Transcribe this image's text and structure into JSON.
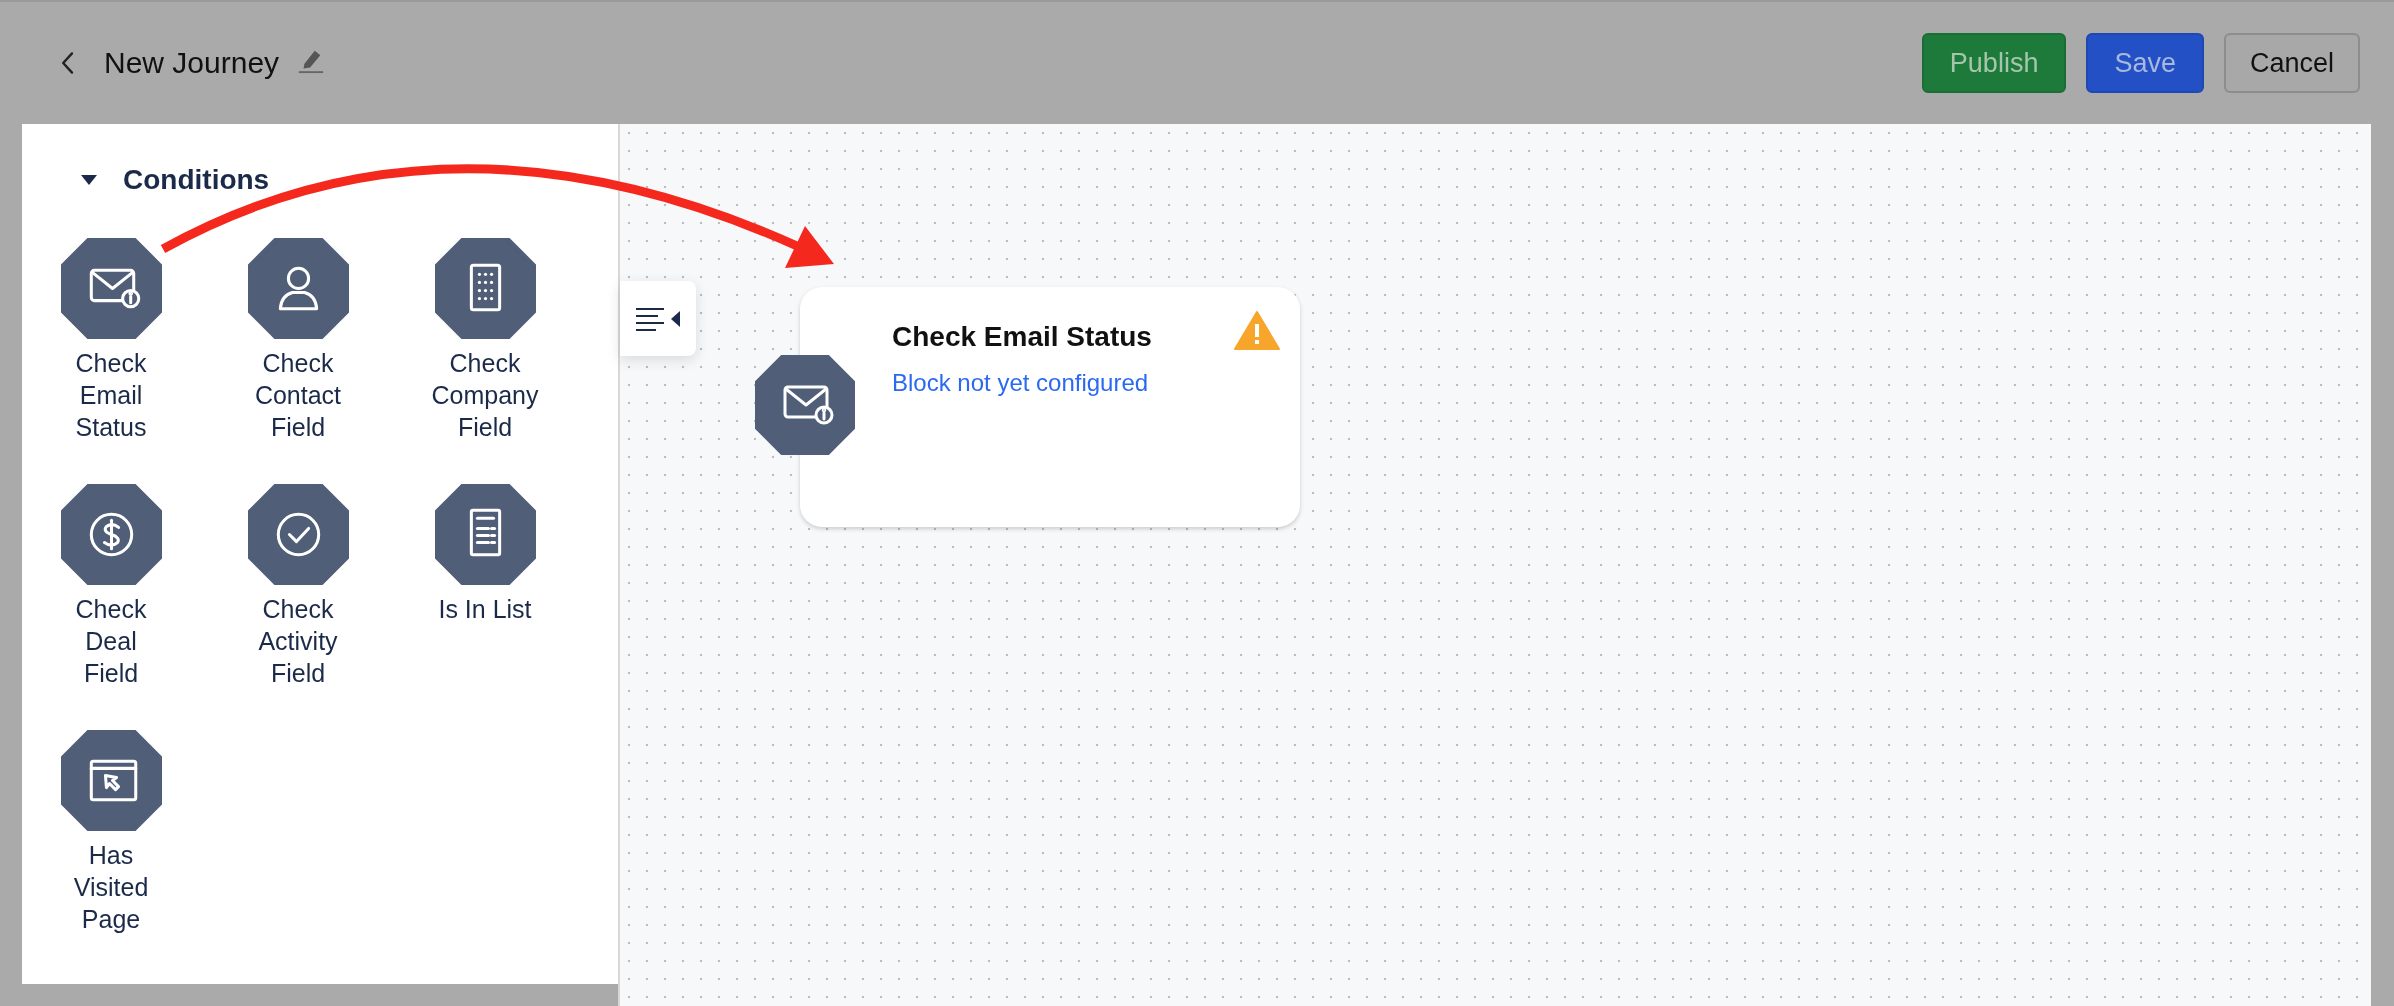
{
  "header": {
    "title": "New Journey",
    "buttons": [
      {
        "label": "Publish",
        "kind": "publish"
      },
      {
        "label": "Save",
        "kind": "save"
      },
      {
        "label": "Cancel",
        "kind": "cancel"
      }
    ]
  },
  "sidebar": {
    "section": {
      "title": "Conditions",
      "expanded": true
    },
    "items": [
      {
        "label": "Check Email Status",
        "kind": "mail"
      },
      {
        "label": "Check Contact Field",
        "kind": "person"
      },
      {
        "label": "Check Company Field",
        "kind": "building"
      },
      {
        "label": "Check Deal Field",
        "kind": "dollar"
      },
      {
        "label": "Check Activity Field",
        "kind": "check"
      },
      {
        "label": "Is In List",
        "kind": "list"
      },
      {
        "label": "Has Visited Page",
        "kind": "browser"
      }
    ]
  },
  "canvas": {
    "node": {
      "title": "Check Email Status",
      "status": "Block not yet configured",
      "kind": "mail",
      "warning": true
    }
  }
}
